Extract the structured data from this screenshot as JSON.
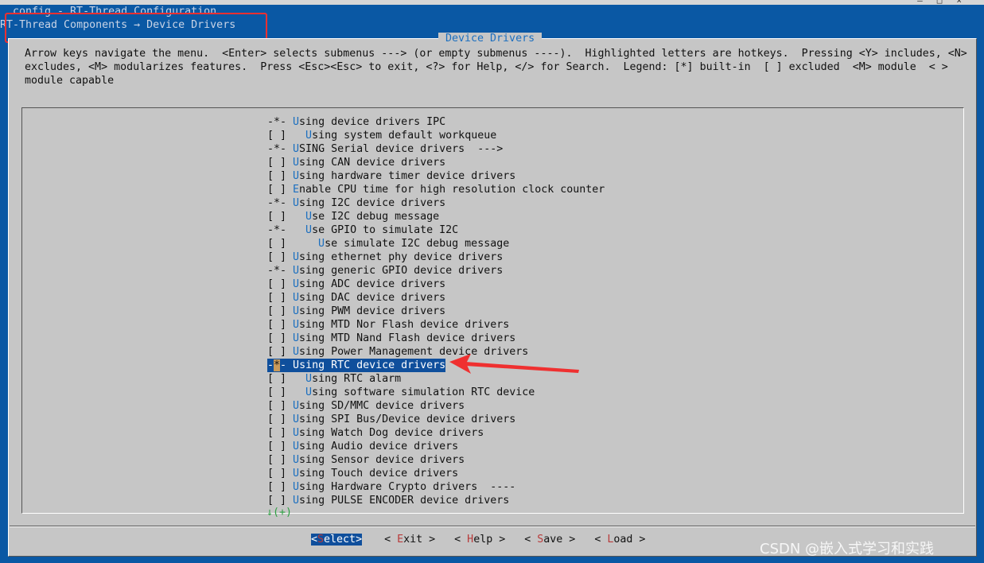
{
  "window": {
    "config_line": ".config - RT-Thread Configuration",
    "breadcrumb": "RT-Thread Components → Device Drivers",
    "controls": [
      "–",
      "□",
      "×"
    ]
  },
  "dialog": {
    "title": " Device Drivers ",
    "help": "Arrow keys navigate the menu.  <Enter> selects submenus ---> (or empty submenus ----).  Highlighted letters are hotkeys.  Pressing <Y> includes, <N> excludes, <M> modularizes features.  Press <Esc><Esc> to exit, <?> for Help, </> for Search.  Legend: [*] built-in  [ ] excluded  <M> module  < > module capable"
  },
  "menu": {
    "items": [
      {
        "prefix": "-*- ",
        "hotkey": "U",
        "rest": "sing device drivers IPC"
      },
      {
        "prefix": "[ ]   ",
        "hotkey": "U",
        "rest": "sing system default workqueue"
      },
      {
        "prefix": "-*- ",
        "hotkey": "U",
        "rest": "SING Serial device drivers  --->"
      },
      {
        "prefix": "[ ] ",
        "hotkey": "U",
        "rest": "sing CAN device drivers"
      },
      {
        "prefix": "[ ] ",
        "hotkey": "U",
        "rest": "sing hardware timer device drivers"
      },
      {
        "prefix": "[ ] ",
        "hotkey": "E",
        "rest": "nable CPU time for high resolution clock counter"
      },
      {
        "prefix": "-*- ",
        "hotkey": "U",
        "rest": "sing I2C device drivers"
      },
      {
        "prefix": "[ ]   ",
        "hotkey": "U",
        "rest": "se I2C debug message"
      },
      {
        "prefix": "-*-   ",
        "hotkey": "U",
        "rest": "se GPIO to simulate I2C"
      },
      {
        "prefix": "[ ]     ",
        "hotkey": "U",
        "rest": "se simulate I2C debug message"
      },
      {
        "prefix": "[ ] ",
        "hotkey": "U",
        "rest": "sing ethernet phy device drivers"
      },
      {
        "prefix": "-*- ",
        "hotkey": "U",
        "rest": "sing generic GPIO device drivers"
      },
      {
        "prefix": "[ ] ",
        "hotkey": "U",
        "rest": "sing ADC device drivers"
      },
      {
        "prefix": "[ ] ",
        "hotkey": "U",
        "rest": "sing DAC device drivers"
      },
      {
        "prefix": "[ ] ",
        "hotkey": "U",
        "rest": "sing PWM device drivers"
      },
      {
        "prefix": "[ ] ",
        "hotkey": "U",
        "rest": "sing MTD Nor Flash device drivers"
      },
      {
        "prefix": "[ ] ",
        "hotkey": "U",
        "rest": "sing MTD Nand Flash device drivers"
      },
      {
        "prefix": "[ ] ",
        "hotkey": "U",
        "rest": "sing Power Management device drivers"
      },
      {
        "prefix": "-*- ",
        "hotkey": "U",
        "rest": "sing RTC device drivers",
        "selected": true
      },
      {
        "prefix": "[ ]   ",
        "hotkey": "U",
        "rest": "sing RTC alarm"
      },
      {
        "prefix": "[ ]   ",
        "hotkey": "U",
        "rest": "sing software simulation RTC device"
      },
      {
        "prefix": "[ ] ",
        "hotkey": "U",
        "rest": "sing SD/MMC device drivers"
      },
      {
        "prefix": "[ ] ",
        "hotkey": "U",
        "rest": "sing SPI Bus/Device device drivers"
      },
      {
        "prefix": "[ ] ",
        "hotkey": "U",
        "rest": "sing Watch Dog device drivers"
      },
      {
        "prefix": "[ ] ",
        "hotkey": "U",
        "rest": "sing Audio device drivers"
      },
      {
        "prefix": "[ ] ",
        "hotkey": "U",
        "rest": "sing Sensor device drivers"
      },
      {
        "prefix": "[ ] ",
        "hotkey": "U",
        "rest": "sing Touch device drivers"
      },
      {
        "prefix": "[ ] ",
        "hotkey": "U",
        "rest": "sing Hardware Crypto drivers  ----"
      },
      {
        "prefix": "[ ] ",
        "hotkey": "U",
        "rest": "sing PULSE ENCODER device drivers"
      }
    ],
    "more_indicator": "↓(+)"
  },
  "buttons": [
    {
      "name": "select",
      "left": "<",
      "hotkey": "S",
      "rest": "elect",
      "right": ">",
      "active": true
    },
    {
      "name": "exit",
      "left": "< ",
      "hotkey": "E",
      "rest": "xit",
      "right": " >"
    },
    {
      "name": "help",
      "left": "< ",
      "hotkey": "H",
      "rest": "elp",
      "right": " >"
    },
    {
      "name": "save",
      "left": "< ",
      "hotkey": "S",
      "rest": "ave",
      "right": " >"
    },
    {
      "name": "load",
      "left": "< ",
      "hotkey": "L",
      "rest": "oad",
      "right": " >"
    }
  ],
  "watermark": "CSDN @嵌入式学习和实践",
  "colors": {
    "annotation": "#ef3030",
    "selection": "#0f4f9c",
    "hotkey": "#1c6fbf"
  }
}
